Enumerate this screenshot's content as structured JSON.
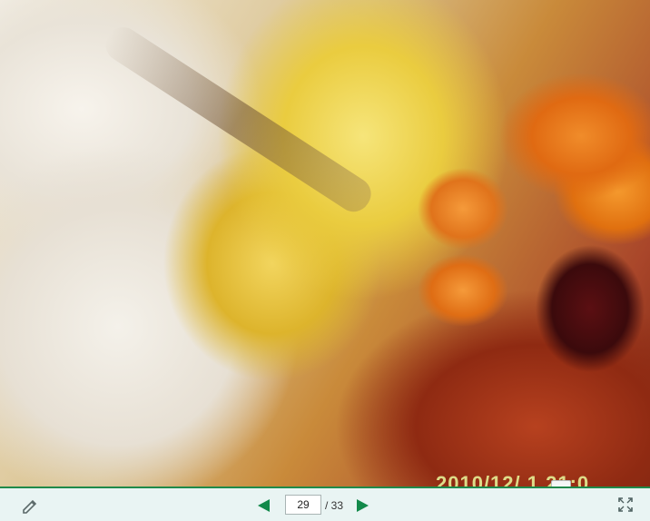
{
  "photo": {
    "alt": "",
    "date_stamp": "2010/12/ 1 21:0"
  },
  "toolbar": {
    "edit_icon": "pencil-icon",
    "prev_icon": "arrow-left-icon",
    "next_icon": "arrow-right-icon",
    "fullscreen_icon": "expand-icon",
    "current_page": "29",
    "total_pages": "/ 33",
    "accent_color": "#1f8a4a"
  }
}
